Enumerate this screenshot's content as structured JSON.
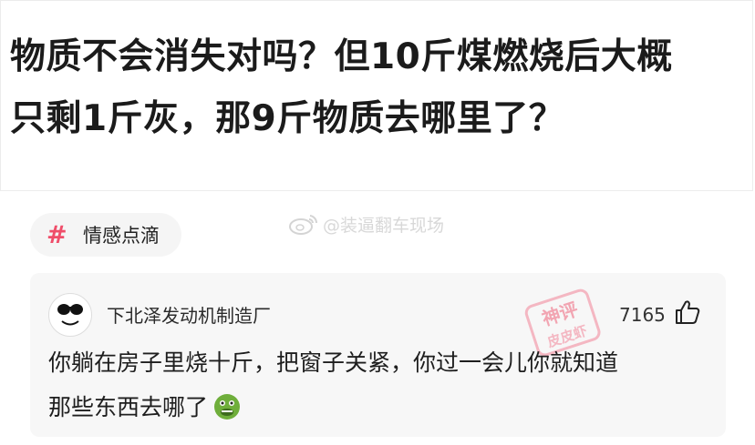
{
  "question": {
    "line1": "物质不会消失对吗？但10斤煤燃烧后大概",
    "line2": "只剩1斤灰，那9斤物质去哪里了？"
  },
  "topic": {
    "icon": "hash-icon",
    "label": "情感点滴"
  },
  "watermark": {
    "icon": "weibo-icon",
    "text": "@装逼翻车现场"
  },
  "comment": {
    "username": "下北泽发动机制造厂",
    "likes": "7165",
    "like_icon": "thumb-up-icon",
    "line1": "你躺在房子里烧十斤，把窗子关紧，你过一会儿你就知道",
    "line2": "那些东西去哪了",
    "emoji": "sick-face-emoji",
    "stamp_top": "神评",
    "stamp_bottom": "皮皮虾"
  },
  "colors": {
    "accent": "#ef4e6a",
    "card_bg": "#f7f7f7",
    "stamp": "#f2a5b2"
  }
}
